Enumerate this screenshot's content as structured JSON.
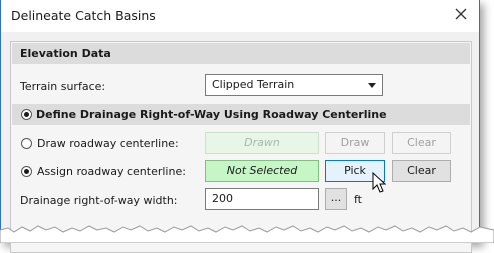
{
  "window": {
    "title": "Delineate Catch Basins"
  },
  "elevation_section": {
    "header": "Elevation Data",
    "terrain_label": "Terrain surface:",
    "terrain_value": "Clipped Terrain"
  },
  "row_section": {
    "header": "Define Drainage Right-of-Way Using Roadway Centerline",
    "draw_label": "Draw roadway centerline:",
    "draw_field": "Drawn",
    "draw_button": "Draw",
    "draw_clear": "Clear",
    "assign_label": "Assign roadway centerline:",
    "assign_field": "Not Selected",
    "pick_button": "Pick",
    "assign_clear": "Clear",
    "width_label": "Drainage right-of-way width:",
    "width_value": "200",
    "width_browse": "...",
    "width_unit": "ft"
  },
  "colors": {
    "accent": "#2c72c7",
    "not_selected_bg": "#c6f5c6",
    "drawn_bg": "#e8f6e8"
  }
}
